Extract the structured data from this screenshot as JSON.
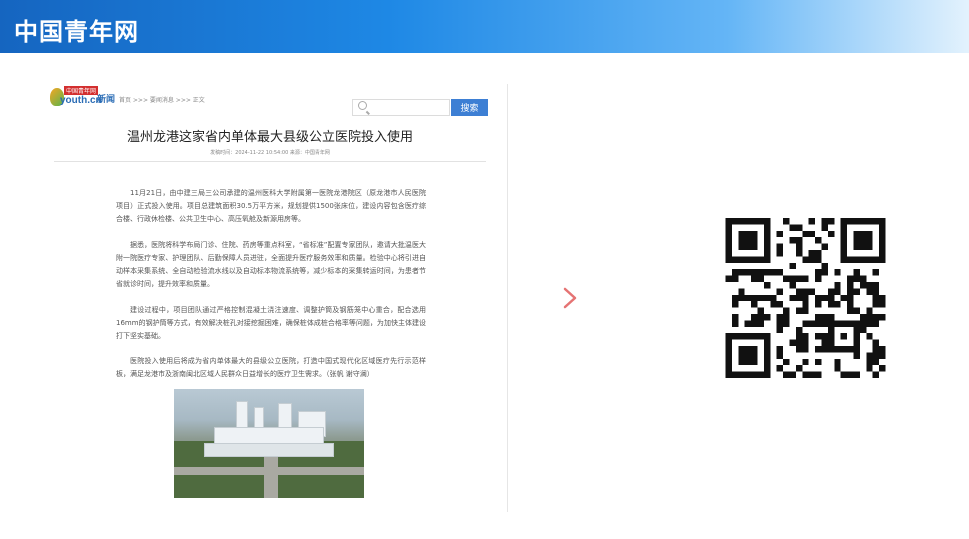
{
  "header": {
    "logo": "中国青年网"
  },
  "article": {
    "brand_mini": "中国青年网",
    "brand_domain": "youth.cn",
    "brand_news": "新闻",
    "breadcrumb": "首页 >>> 要闻消息 >>> 正文",
    "search_button": "搜索",
    "search_placeholder": "",
    "title": "温州龙港这家省内单体最大县级公立医院投入使用",
    "meta": "发稿时间：2024-11-22 10:54:00 来源：中国青年网",
    "paragraphs": [
      "11月21日，由中建三局三公司承建的温州医科大学附属第一医院龙港院区（原龙港市人民医院项目）正式投入使用。项目总建筑面积30.5万平方米，规划提供1500张床位，建设内容包含医疗综合楼、行政休检楼、公共卫生中心、高压氧舱及新源用房等。",
      "据悉，医院将科学布局门诊、住院、药房等重点科室，“省标准”配置专家团队，邀请大批温医大附一院医疗专家、护理团队、后勤保障人员进驻，全面提升医疗服务效率和质量。检验中心将引进自动样本采集系统、全自动检验流水线以及自动标本物流系统等，减少标本的采集转运时间，为患者节省就诊时间，提升效率和质量。",
      "建设过程中，项目团队通过严格控制混凝土浇注速度、调整护筒及钢筋笼中心重合，配合选用16mm的钢护筒等方式，有效解决桩孔对接挖掘困难，确保桩体成桩合格率等问题，为加快主体建设打下坚实基础。",
      "医院投入使用后将成为省内单体最大的县级公立医院，打造中国式现代化区域医疗先行示范样板，满足龙港市及浙南闽北区域人民群众日益增长的医疗卫生需求。（张帆 谢守澜）"
    ]
  },
  "qr": {
    "label": "qr-code"
  },
  "colors": {
    "topbar": "#1e88e5",
    "accent_arrow": "#e57373",
    "search_button": "#3d7fd4"
  }
}
